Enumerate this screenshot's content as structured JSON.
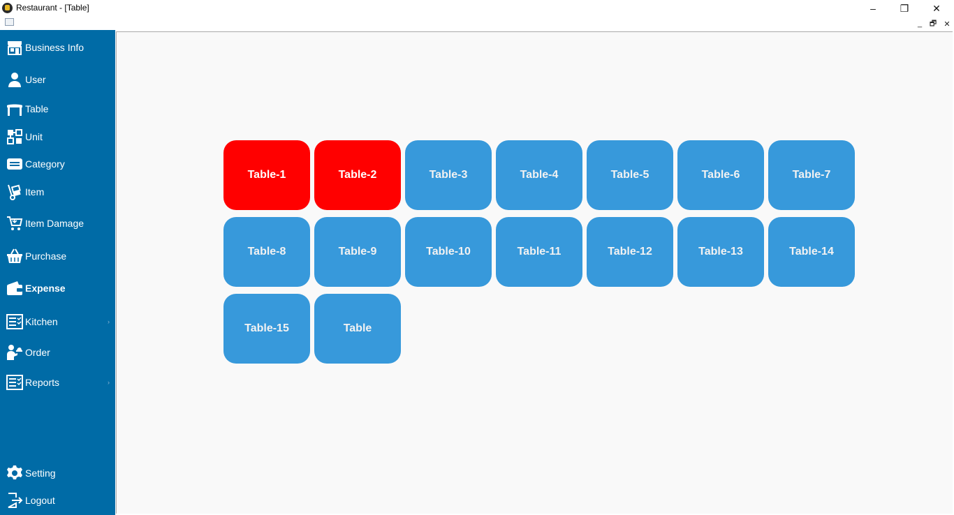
{
  "window": {
    "title": "Restaurant - [Table]",
    "controls": {
      "minimize": "–",
      "restore": "❐",
      "close": "✕"
    },
    "mdi_controls": {
      "minimize": "_",
      "restore": "🗗",
      "close": "✕"
    }
  },
  "sidebar": {
    "items": [
      {
        "label": "Business Info",
        "icon": "store-icon"
      },
      {
        "label": "User",
        "icon": "user-icon"
      },
      {
        "label": "Table",
        "icon": "table-icon"
      },
      {
        "label": "Unit",
        "icon": "unit-icon"
      },
      {
        "label": "Category",
        "icon": "category-icon"
      },
      {
        "label": "Item",
        "icon": "hand-truck-icon"
      },
      {
        "label": "Item Damage",
        "icon": "cart-icon"
      },
      {
        "label": "Purchase",
        "icon": "basket-icon"
      },
      {
        "label": "Expense",
        "icon": "wallet-icon",
        "bold": true
      },
      {
        "label": "Kitchen",
        "icon": "checklist-icon",
        "submenu": "›"
      },
      {
        "label": "Order",
        "icon": "waiter-icon"
      },
      {
        "label": "Reports",
        "icon": "checklist-icon",
        "submenu": "›"
      },
      {
        "label": "Setting",
        "icon": "gear-icon"
      },
      {
        "label": "Logout",
        "icon": "logout-icon"
      }
    ]
  },
  "tables": [
    {
      "label": "Table-1",
      "status": "occupied"
    },
    {
      "label": "Table-2",
      "status": "occupied"
    },
    {
      "label": "Table-3",
      "status": "free"
    },
    {
      "label": "Table-4",
      "status": "free"
    },
    {
      "label": "Table-5",
      "status": "free"
    },
    {
      "label": "Table-6",
      "status": "free"
    },
    {
      "label": "Table-7",
      "status": "free"
    },
    {
      "label": "Table-8",
      "status": "free"
    },
    {
      "label": "Table-9",
      "status": "free"
    },
    {
      "label": "Table-10",
      "status": "free"
    },
    {
      "label": "Table-11",
      "status": "free"
    },
    {
      "label": "Table-12",
      "status": "free"
    },
    {
      "label": "Table-13",
      "status": "free"
    },
    {
      "label": "Table-14",
      "status": "free"
    },
    {
      "label": "Table-15",
      "status": "free"
    },
    {
      "label": "Table",
      "status": "free"
    }
  ],
  "colors": {
    "sidebar": "#006ba6",
    "free": "#3799db",
    "occupied": "#ff0000"
  }
}
